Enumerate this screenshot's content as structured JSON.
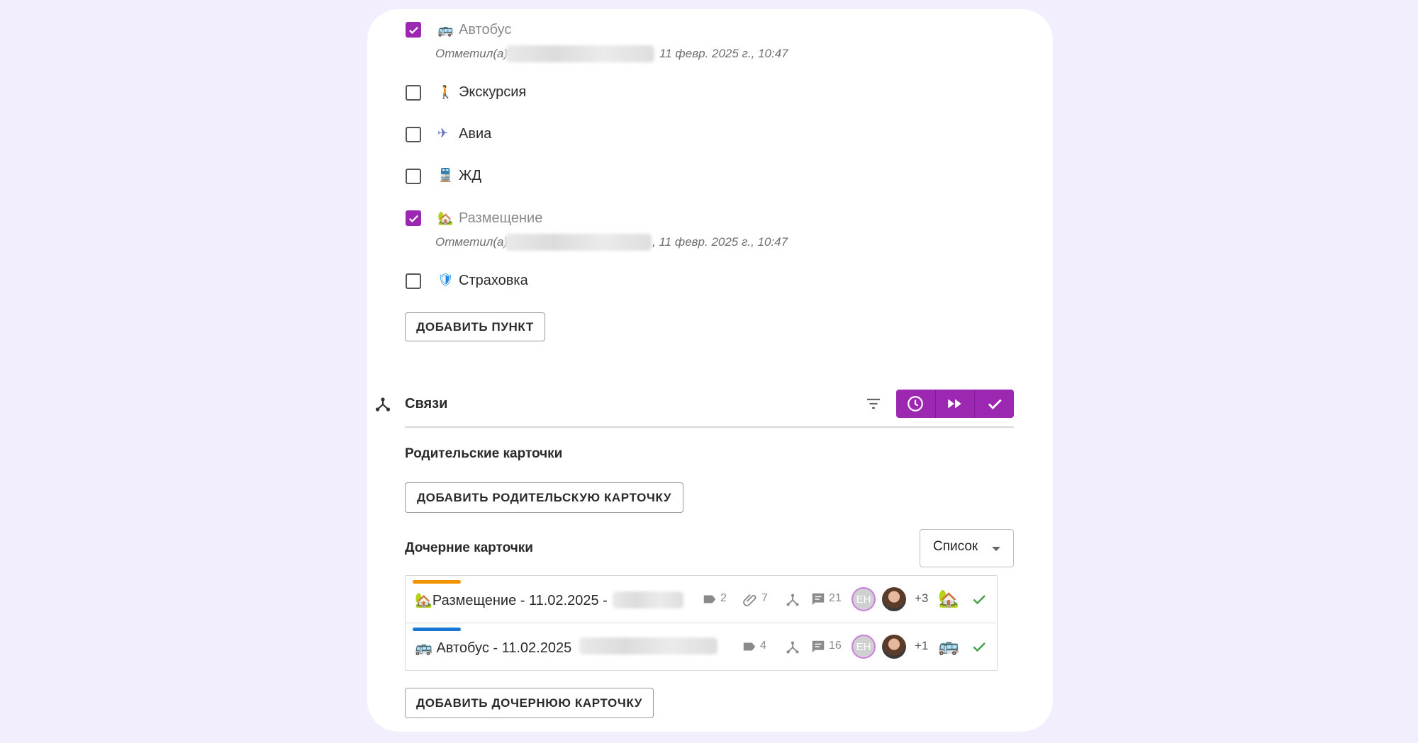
{
  "checklist": {
    "items": [
      {
        "emoji": "🚌",
        "label": "Автобус",
        "checked": true,
        "meta_prefix": "Отметил(а)",
        "meta_suffix": "11 февр. 2025 г., 10:47"
      },
      {
        "emoji": "🚶",
        "label": "Экскурсия",
        "checked": false
      },
      {
        "emoji": "✈",
        "label": "Авиа",
        "checked": false
      },
      {
        "emoji": "🚆",
        "label": "ЖД",
        "checked": false
      },
      {
        "emoji": "🏡",
        "label": "Размещение",
        "checked": true,
        "meta_prefix": "Отметил(а)",
        "meta_suffix": ", 11 февр. 2025 г., 10:47"
      },
      {
        "emoji": "🛡",
        "label": "Страховка",
        "checked": false
      }
    ],
    "add_button": "ДОБАВИТЬ ПУНКТ"
  },
  "relations": {
    "title": "Связи",
    "parent_heading": "Родительские карточки",
    "add_parent_button": "ДОБАВИТЬ РОДИТЕЛЬСКУЮ КАРТОЧКУ",
    "child_heading": "Дочерние карточки",
    "view_select": "Список",
    "add_child_button": "ДОБАВИТЬ ДОЧЕРНЮЮ КАРТОЧКУ",
    "children": [
      {
        "title": "🏡Размещение - 11.02.2025 -",
        "bar_color": "#f39200",
        "labels": "2",
        "attachments": "7",
        "comments": "21",
        "avatar_initials": "ЕН",
        "extra": "+3",
        "type_emoji": "🏡"
      },
      {
        "title": "🚌 Автобус - 11.02.2025",
        "bar_color": "#1976d2",
        "labels": "4",
        "comments": "16",
        "avatar_initials": "ЕН",
        "extra": "+1",
        "type_emoji": "🚌"
      }
    ]
  },
  "colors": {
    "accent": "#9c27b0",
    "success": "#43a047"
  }
}
